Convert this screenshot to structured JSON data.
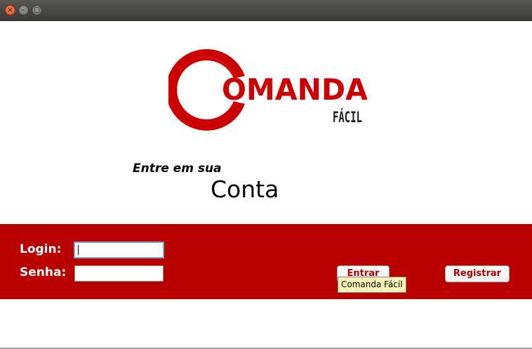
{
  "window": {
    "close_glyph": "×",
    "minimize_glyph": "–",
    "maximize_glyph": "□"
  },
  "logo": {
    "brand": "OMANDA",
    "tagline": "FÁCIL",
    "color": "#cc0000"
  },
  "login_panel": {
    "subtitle": "Entre em sua",
    "heading": "Conta",
    "background_color": "#b80000",
    "login_label": "Login:",
    "login_value": "",
    "password_label": "Senha:",
    "password_value": "",
    "submit_label": "Entrar",
    "register_label": "Registrar",
    "tooltip": "Comanda Fácil"
  }
}
